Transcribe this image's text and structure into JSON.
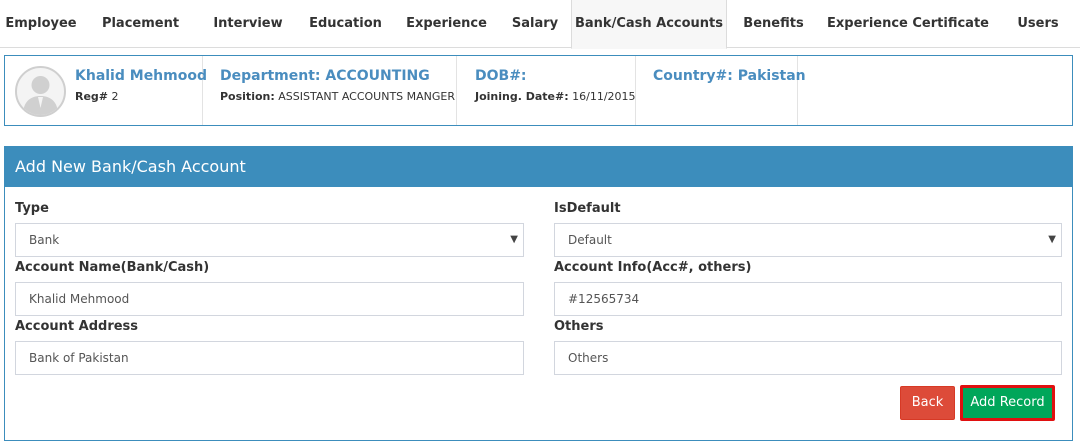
{
  "tabs": [
    {
      "label": "Employee",
      "active": false
    },
    {
      "label": "Placement",
      "active": false
    },
    {
      "label": "Interview",
      "active": false
    },
    {
      "label": "Education",
      "active": false
    },
    {
      "label": "Experience",
      "active": false
    },
    {
      "label": "Salary",
      "active": false
    },
    {
      "label": "Bank/Cash Accounts",
      "active": true
    },
    {
      "label": "Benefits",
      "active": false
    },
    {
      "label": "Experience Certificate",
      "active": false
    },
    {
      "label": "Users",
      "active": false
    }
  ],
  "profile": {
    "name": "Khalid Mehmood",
    "reg_label": "Reg#",
    "reg_value": "2",
    "department": "Department: ACCOUNTING",
    "position_label": "Position:",
    "position_value": "ASSISTANT ACCOUNTS MANGER",
    "dob": "DOB#:",
    "joining_label": "Joining. Date#:",
    "joining_value": "16/11/2015",
    "country": "Country#: Pakistan"
  },
  "form": {
    "title": "Add New Bank/Cash Account",
    "type_label": "Type",
    "type_value": "Bank",
    "isdefault_label": "IsDefault",
    "isdefault_value": "Default",
    "account_name_label": "Account Name(Bank/Cash)",
    "account_name_value": "Khalid Mehmood",
    "account_info_label": "Account Info(Acc#, others)",
    "account_info_value": "#12565734",
    "account_address_label": "Account Address",
    "account_address_value": "Bank of Pakistan",
    "others_label": "Others",
    "others_value": "Others",
    "back_label": "Back",
    "add_label": "Add Record"
  },
  "icons": {
    "avatar": "user-silhouette-icon",
    "caret": "caret-down-icon"
  },
  "colors": {
    "primary": "#3c8dbc",
    "name_blue": "#4a8dbf",
    "danger": "#dd4b39",
    "success": "#00a65a",
    "highlight": "#e01010"
  }
}
